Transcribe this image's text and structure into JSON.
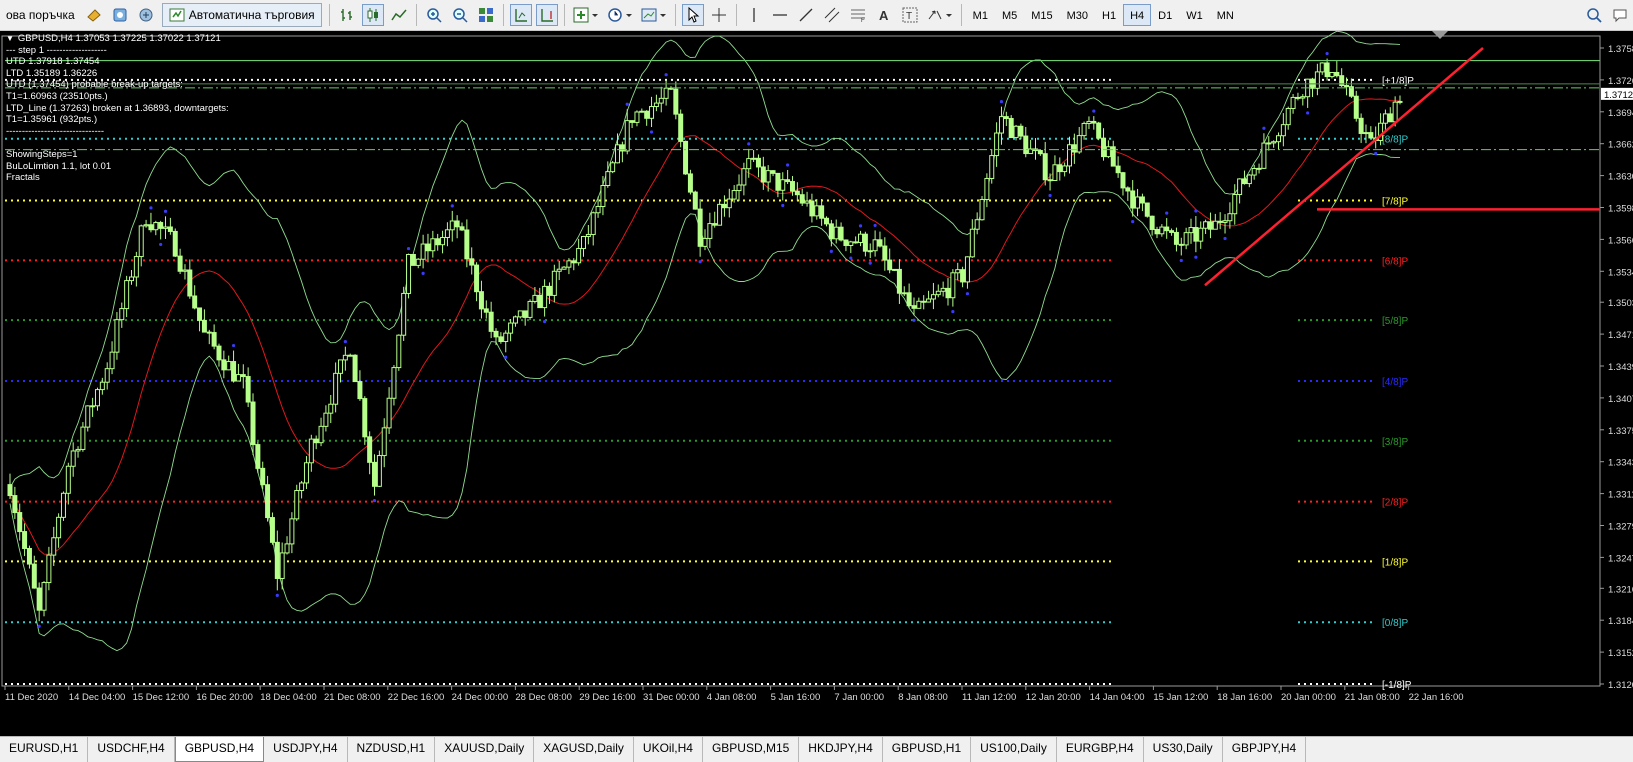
{
  "toolbar": {
    "new_order_label": "ова поръчка",
    "autotrading_label": "Автоматична търговия",
    "timeframes": [
      "M1",
      "M5",
      "M15",
      "M30",
      "H1",
      "H4",
      "D1",
      "W1",
      "MN"
    ],
    "active_timeframe": "H4"
  },
  "chart_info": {
    "header": "GBPUSD,H4  1.37053 1.37225 1.37022 1.37121",
    "lines": [
      "---   step 1   -------------------",
      "UTD 1.37918  1.37454",
      "LTD  1.35189  1.36226",
      "UTD (1.37454) probable break-up targets:",
      "T1=1.60963 (23510pts.)",
      "LTD_Line (1.37263) broken at 1.36893, downtargets:",
      "T1=1.35961 (932pts.)",
      "-------------------------------",
      "",
      "ShowingSteps=1",
      "BuLoLimtion 1.1, lot 0.01",
      "Fractals"
    ]
  },
  "chart_data": {
    "type": "candlestick",
    "symbol": "GBPUSD",
    "timeframe": "H4",
    "ohlc_readout": {
      "open": 1.37053,
      "high": 1.37225,
      "low": 1.37022,
      "close": 1.37121
    },
    "current_price": 1.3712,
    "price_axis_ticks": [
      "1.3758",
      "1.3726",
      "1.3694",
      "1.3662",
      "1.3630",
      "1.3598",
      "1.3566",
      "1.3534",
      "1.3503",
      "1.3471",
      "1.3439",
      "1.3407",
      "1.3375",
      "1.3343",
      "1.3311",
      "1.3279",
      "1.3247",
      "1.3216",
      "1.3184",
      "1.3152",
      "1.3120"
    ],
    "time_axis_labels": [
      "11 Dec 2020",
      "14 Dec 04:00",
      "15 Dec 12:00",
      "16 Dec 20:00",
      "18 Dec 04:00",
      "21 Dec 08:00",
      "22 Dec 16:00",
      "24 Dec 00:00",
      "28 Dec 08:00",
      "29 Dec 16:00",
      "31 Dec 00:00",
      "4 Jan 08:00",
      "5 Jan 16:00",
      "7 Jan 00:00",
      "8 Jan 08:00",
      "11 Jan 12:00",
      "12 Jan 20:00",
      "14 Jan 04:00",
      "15 Jan 12:00",
      "18 Jan 16:00",
      "20 Jan 00:00",
      "21 Jan 08:00",
      "22 Jan 16:00"
    ],
    "murrey_levels": [
      {
        "label": "[+1/8]P",
        "price": 1.3726,
        "color": "#ffffff"
      },
      {
        "label": "[8/8]P",
        "price": 1.3667,
        "color": "#33cccc"
      },
      {
        "label": "[7/8]P",
        "price": 1.3605,
        "color": "#ffff33"
      },
      {
        "label": "[6/8]P",
        "price": 1.3545,
        "color": "#ff2020"
      },
      {
        "label": "[5/8]P",
        "price": 1.3485,
        "color": "#2a9a2a"
      },
      {
        "label": "[4/8]P",
        "price": 1.3424,
        "color": "#2a2aff"
      },
      {
        "label": "[3/8]P",
        "price": 1.3364,
        "color": "#2a9a2a"
      },
      {
        "label": "[2/8]P",
        "price": 1.3303,
        "color": "#ff2020"
      },
      {
        "label": "[1/8]P",
        "price": 1.3243,
        "color": "#ffff33"
      },
      {
        "label": "[0/8]P",
        "price": 1.3182,
        "color": "#33cccc"
      },
      {
        "label": "[-1/8]P",
        "price": 1.312,
        "color": "#ffffff"
      }
    ],
    "colors": {
      "background": "#000000",
      "candle": "#b6ff8a",
      "moving_average": "#e0181c",
      "bands": "#8fdc8f",
      "trendline": "#ff2030",
      "fractal": "#3a3aff"
    }
  },
  "tabs": {
    "items": [
      "EURUSD,H1",
      "USDCHF,H4",
      "GBPUSD,H4",
      "USDJPY,H4",
      "NZDUSD,H1",
      "XAUUSD,Daily",
      "XAGUSD,Daily",
      "UKOil,H4",
      "GBPUSD,M15",
      "HKDJPY,H4",
      "GBPUSD,H1",
      "US100,Daily",
      "EURGBP,H4",
      "US30,Daily",
      "GBPJPY,H4"
    ],
    "active": "GBPUSD,H4"
  }
}
